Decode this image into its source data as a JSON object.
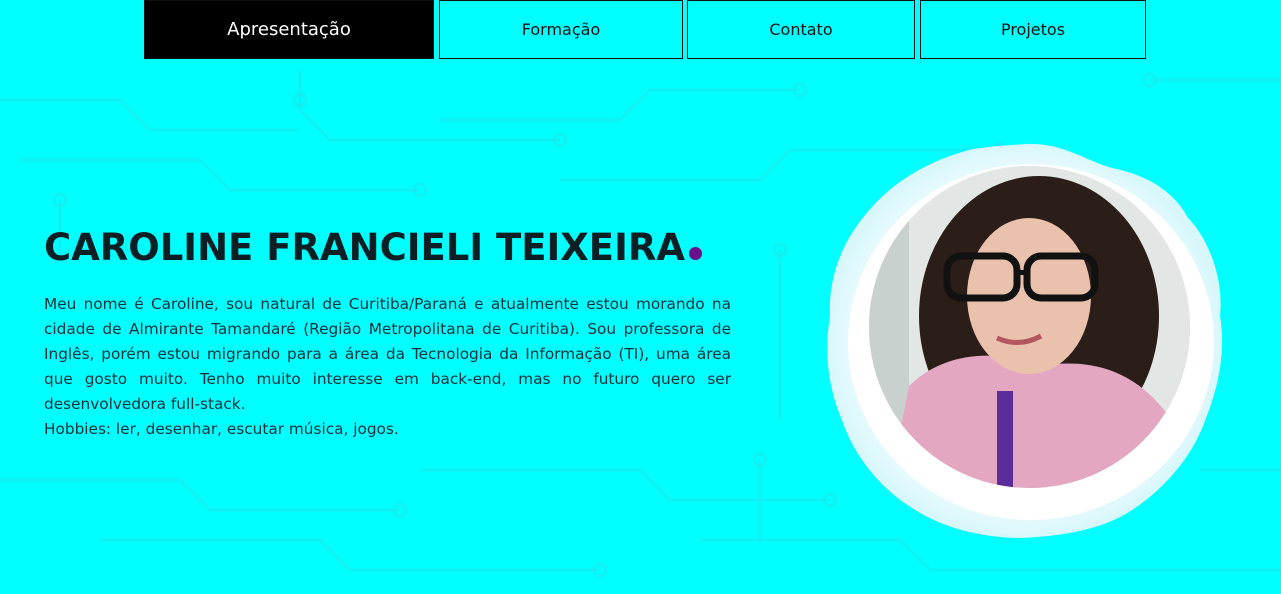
{
  "nav": {
    "tabs": [
      {
        "label": "Apresentação",
        "active": true
      },
      {
        "label": "Formação",
        "active": false
      },
      {
        "label": "Contato",
        "active": false
      },
      {
        "label": "Projetos",
        "active": false
      }
    ]
  },
  "hero": {
    "name": "CAROLINE FRANCIELI TEIXEIRA",
    "bio": "Meu nome é Caroline, sou natural de Curitiba/Paraná e atualmente estou morando na cidade de Almirante Tamandaré (Região Metropolitana de Curitiba). Sou professora de Inglês, porém estou migrando para a área da Tecnologia da Informação (TI), uma área que gosto muito. Tenho muito interesse em back-end, mas no futuro quero ser desenvolvedora full-stack.",
    "hobbies": "Hobbies: ler, desenhar, escutar música, jogos."
  },
  "colors": {
    "background": "#00ffff",
    "active_tab": "#000000",
    "accent_dot": "#6b0f8a",
    "text": "#0b1f24"
  }
}
